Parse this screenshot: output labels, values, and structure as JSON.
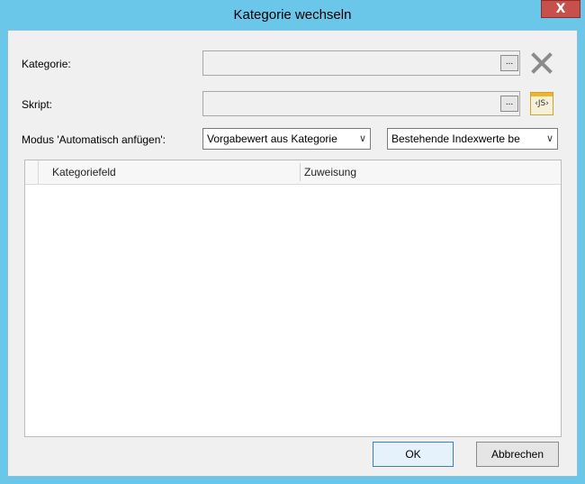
{
  "window": {
    "title": "Kategorie wechseln",
    "close_symbol": "X"
  },
  "form": {
    "category_label": "Kategorie:",
    "category_value": "",
    "browse_label": "...",
    "script_label": "Skript:",
    "script_value": "",
    "js_label": "JS",
    "mode_label": "Modus 'Automatisch anfügen':",
    "mode_select_value": "Vorgabewert aus Kategorie",
    "index_select_value": "Bestehende Indexwerte be"
  },
  "grid": {
    "columns": [
      "Kategoriefeld",
      "Zuweisung"
    ],
    "rows": []
  },
  "buttons": {
    "ok": "OK",
    "cancel": "Abbrechen"
  }
}
